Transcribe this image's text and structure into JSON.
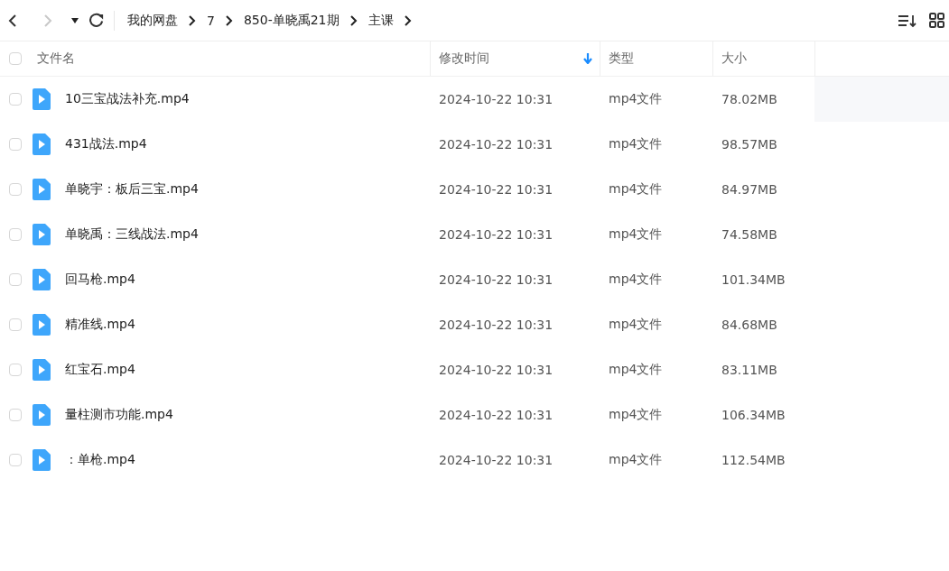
{
  "toolbar": {
    "back_disabled": false,
    "forward_disabled": true,
    "breadcrumb": [
      "我的网盘",
      "7",
      "850-单晓禹21期",
      "主课"
    ]
  },
  "table": {
    "select_all": false,
    "columns": [
      {
        "label": "文件名",
        "sorted": false
      },
      {
        "label": "修改时间",
        "sorted": true
      },
      {
        "label": "类型",
        "sorted": false
      },
      {
        "label": "大小",
        "sorted": false
      }
    ],
    "rows": [
      {
        "name": "10三宝战法补充.mp4",
        "modified": "2024-10-22 10:31",
        "type": "mp4文件",
        "size": "78.02MB",
        "checked": false,
        "hovered": true
      },
      {
        "name": "431战法.mp4",
        "modified": "2024-10-22 10:31",
        "type": "mp4文件",
        "size": "98.57MB",
        "checked": false,
        "hovered": false
      },
      {
        "name": "单晓宇：板后三宝.mp4",
        "modified": "2024-10-22 10:31",
        "type": "mp4文件",
        "size": "84.97MB",
        "checked": false,
        "hovered": false
      },
      {
        "name": "单晓禹：三线战法.mp4",
        "modified": "2024-10-22 10:31",
        "type": "mp4文件",
        "size": "74.58MB",
        "checked": false,
        "hovered": false
      },
      {
        "name": "回马枪.mp4",
        "modified": "2024-10-22 10:31",
        "type": "mp4文件",
        "size": "101.34MB",
        "checked": false,
        "hovered": false
      },
      {
        "name": "精准线.mp4",
        "modified": "2024-10-22 10:31",
        "type": "mp4文件",
        "size": "84.68MB",
        "checked": false,
        "hovered": false
      },
      {
        "name": "红宝石.mp4",
        "modified": "2024-10-22 10:31",
        "type": "mp4文件",
        "size": "83.11MB",
        "checked": false,
        "hovered": false
      },
      {
        "name": "量柱测市功能.mp4",
        "modified": "2024-10-22 10:31",
        "type": "mp4文件",
        "size": "106.34MB",
        "checked": false,
        "hovered": false
      },
      {
        "name": "：单枪.mp4",
        "modified": "2024-10-22 10:31",
        "type": "mp4文件",
        "size": "112.54MB",
        "checked": false,
        "hovered": false
      }
    ]
  }
}
